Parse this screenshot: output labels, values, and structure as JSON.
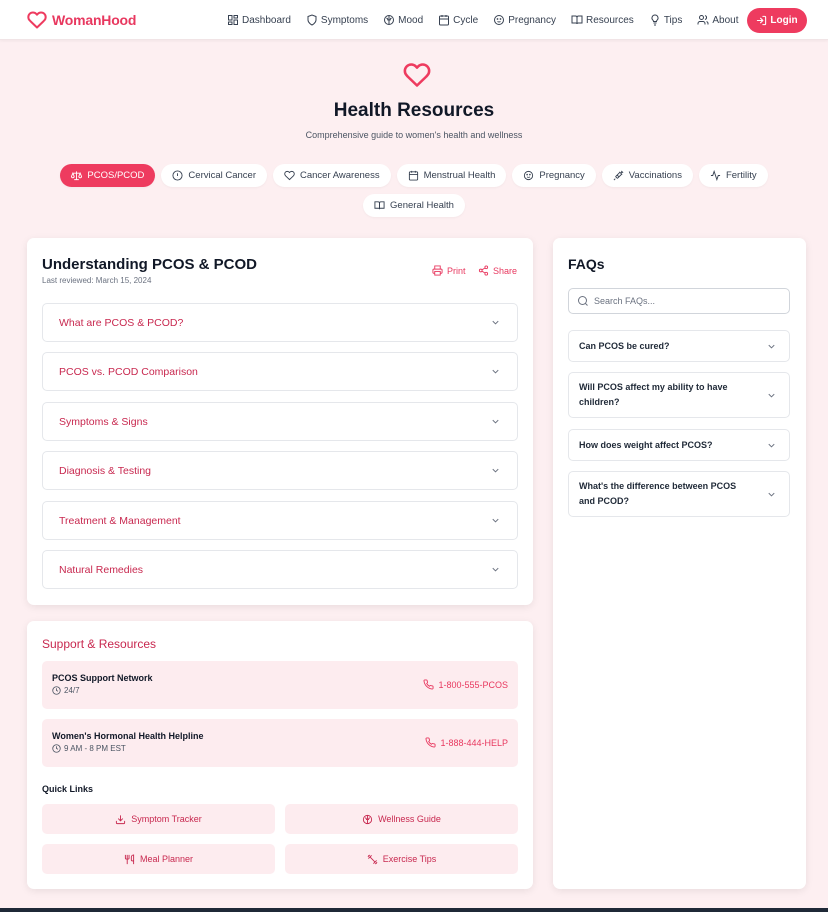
{
  "brand": {
    "name": "WomanHood"
  },
  "nav": {
    "items": [
      {
        "label": "Dashboard",
        "icon": "dashboard-icon"
      },
      {
        "label": "Symptoms",
        "icon": "shield-icon"
      },
      {
        "label": "Mood",
        "icon": "brain-icon"
      },
      {
        "label": "Cycle",
        "icon": "calendar-icon"
      },
      {
        "label": "Pregnancy",
        "icon": "baby-icon"
      },
      {
        "label": "Resources",
        "icon": "book-icon"
      },
      {
        "label": "Tips",
        "icon": "lightbulb-icon"
      },
      {
        "label": "About",
        "icon": "users-icon"
      }
    ],
    "login_label": "Login"
  },
  "hero": {
    "title": "Health Resources",
    "subtitle": "Comprehensive guide to women's health and wellness"
  },
  "tabs": [
    {
      "label": "PCOS/PCOD",
      "icon": "scale-icon",
      "active": true
    },
    {
      "label": "Cervical Cancer",
      "icon": "alert-circle-icon",
      "active": false
    },
    {
      "label": "Cancer Awareness",
      "icon": "heart-icon",
      "active": false
    },
    {
      "label": "Menstrual Health",
      "icon": "calendar-icon",
      "active": false
    },
    {
      "label": "Pregnancy",
      "icon": "baby-icon",
      "active": false
    },
    {
      "label": "Vaccinations",
      "icon": "syringe-icon",
      "active": false
    },
    {
      "label": "Fertility",
      "icon": "activity-icon",
      "active": false
    },
    {
      "label": "General Health",
      "icon": "book-icon",
      "active": false
    }
  ],
  "article": {
    "title": "Understanding PCOS & PCOD",
    "last_reviewed": "Last reviewed: March 15, 2024",
    "print_label": "Print",
    "share_label": "Share",
    "sections": [
      "What are PCOS & PCOD?",
      "PCOS vs. PCOD Comparison",
      "Symptoms & Signs",
      "Diagnosis & Testing",
      "Treatment & Management",
      "Natural Remedies"
    ]
  },
  "support": {
    "title": "Support & Resources",
    "helplines": [
      {
        "name": "PCOS Support Network",
        "hours": "24/7",
        "phone": "1-800-555-PCOS"
      },
      {
        "name": "Women's Hormonal Health Helpline",
        "hours": "9 AM - 8 PM EST",
        "phone": "1-888-444-HELP"
      }
    ],
    "quick_links_title": "Quick Links",
    "quick_links": [
      {
        "label": "Symptom Tracker",
        "icon": "download-icon"
      },
      {
        "label": "Wellness Guide",
        "icon": "brain-icon"
      },
      {
        "label": "Meal Planner",
        "icon": "utensils-icon"
      },
      {
        "label": "Exercise Tips",
        "icon": "dumbbell-icon"
      }
    ]
  },
  "faqs": {
    "title": "FAQs",
    "search_placeholder": "Search FAQs...",
    "items": [
      "Can PCOS be cured?",
      "Will PCOS affect my ability to have children?",
      "How does weight affect PCOS?",
      "What's the difference between PCOS and PCOD?"
    ]
  },
  "colors": {
    "accent": "#ee3b5f",
    "accent_text": "#c8284f",
    "background": "#fdeff1",
    "soft_pink": "#fdecef"
  }
}
